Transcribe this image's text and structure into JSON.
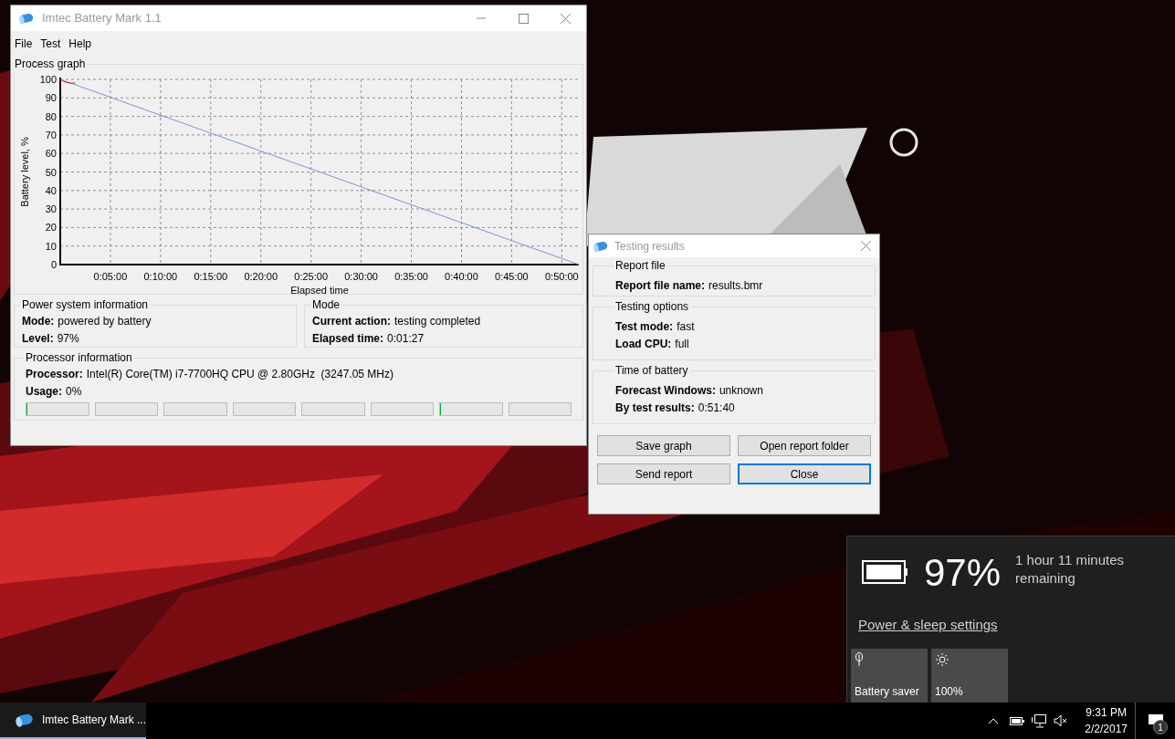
{
  "main_window": {
    "title": "Imtec Battery Mark 1.1",
    "menu": [
      "File",
      "Test",
      "Help"
    ],
    "process_graph": {
      "title": "Process graph",
      "chart_data": {
        "type": "line",
        "grid": true,
        "xlabel": "Elapsed time",
        "ylabel": "Battery level, %",
        "xlim": [
          0,
          51.7
        ],
        "ylim": [
          0,
          100
        ],
        "xticks": [
          {
            "value": 5,
            "label": "0:05:00"
          },
          {
            "value": 10,
            "label": "0:10:00"
          },
          {
            "value": 15,
            "label": "0:15:00"
          },
          {
            "value": 20,
            "label": "0:20:00"
          },
          {
            "value": 25,
            "label": "0:25:00"
          },
          {
            "value": 30,
            "label": "0:30:00"
          },
          {
            "value": 35,
            "label": "0:35:00"
          },
          {
            "value": 40,
            "label": "0:40:00"
          },
          {
            "value": 45,
            "label": "0:45:00"
          },
          {
            "value": 50,
            "label": "0:50:00"
          }
        ],
        "yticks": [
          0,
          10,
          20,
          30,
          40,
          50,
          60,
          70,
          80,
          90,
          100
        ],
        "series": [
          {
            "color": "#7a96d8",
            "x": [
              0,
              51.7
            ],
            "values": [
              100,
              0
            ]
          },
          {
            "color": "#c0281e",
            "x": [
              0,
              0.5,
              1,
              1.5
            ],
            "values": [
              100,
              98.5,
              98,
              98
            ]
          }
        ]
      }
    },
    "power_system": {
      "title": "Power system information",
      "fields": [
        {
          "label": "Mode:",
          "value": "powered by battery"
        },
        {
          "label": "Level:",
          "value": "97%"
        }
      ]
    },
    "mode": {
      "title": "Mode",
      "fields": [
        {
          "label": "Current action:",
          "value": "testing completed"
        },
        {
          "label": "Elapsed time:",
          "value": "0:01:27"
        }
      ]
    },
    "processor": {
      "title": "Processor information",
      "fields": [
        {
          "label": "Processor:",
          "value": "Intel(R) Core(TM) i7-7700HQ CPU @ 2.80GHz  (3247.05 MHz)"
        },
        {
          "label": "Usage:",
          "value": "0%"
        }
      ],
      "cores": [
        {
          "level": 0.02
        },
        {
          "level": 0
        },
        {
          "level": 0
        },
        {
          "level": 0
        },
        {
          "level": 0
        },
        {
          "level": 0
        },
        {
          "level": 0.02
        },
        {
          "level": 0
        }
      ]
    }
  },
  "results_dialog": {
    "title": "Testing results",
    "sections": [
      {
        "title": "Report file",
        "fields": [
          {
            "label": "Report file name:",
            "value": "results.bmr"
          }
        ]
      },
      {
        "title": "Testing options",
        "fields": [
          {
            "label": "Test mode:",
            "value": "fast"
          },
          {
            "label": "Load CPU:",
            "value": "full"
          }
        ]
      },
      {
        "title": "Time of battery",
        "fields": [
          {
            "label": "Forecast Windows:",
            "value": "unknown"
          },
          {
            "label": "By test results:",
            "value": "0:51:40"
          }
        ]
      }
    ],
    "buttons": [
      {
        "label": "Save graph",
        "focused": false
      },
      {
        "label": "Open report folder",
        "focused": false
      },
      {
        "label": "Send report",
        "focused": false
      },
      {
        "label": "Close",
        "focused": true
      }
    ]
  },
  "battery_flyout": {
    "percent": "97%",
    "remaining": "1 hour 11 minutes remaining",
    "link": "Power & sleep settings",
    "tiles": [
      {
        "kind": "battery_saver",
        "label": "Battery saver"
      },
      {
        "kind": "brightness",
        "label": "100%"
      }
    ]
  },
  "taskbar": {
    "apps": [
      {
        "label": "Imtec Battery Mark ...",
        "selected": true
      }
    ],
    "time": "9:31 PM",
    "date": "2/2/2017",
    "notification_count": "1"
  }
}
